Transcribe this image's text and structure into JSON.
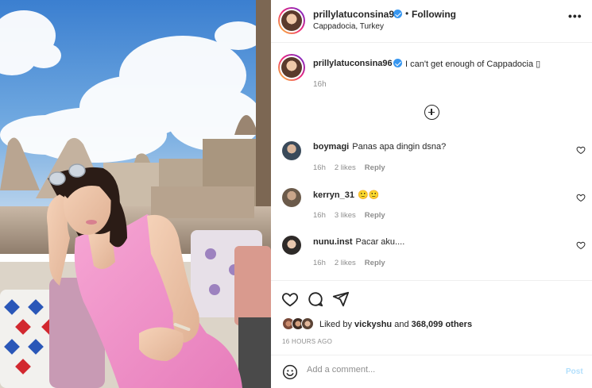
{
  "post": {
    "username": "prillylatuconsina96",
    "separator": "•",
    "follow_status": "Following",
    "location": "Cappadocia, Turkey",
    "more_icon": "more-horizontal-icon",
    "image_alt": "Woman in pink dress sitting on a rooftop terrace in Cappadocia"
  },
  "caption": {
    "username": "prillylatuconsina96",
    "text": "I can't get enough of Cappadocia ▯",
    "time": "16h"
  },
  "load_more_icon": "plus-circle-icon",
  "comments": [
    {
      "username": "boymagi",
      "text": "Panas apa dingin dsna?",
      "time": "16h",
      "likes": "2 likes",
      "reply": "Reply",
      "avatar_color": "#3a4a5a"
    },
    {
      "username": "kerryn_31",
      "text": "🙂🙂",
      "time": "16h",
      "likes": "3 likes",
      "reply": "Reply",
      "avatar_color": "#6b5a4a"
    },
    {
      "username": "nunu.inst",
      "text": "Pacar aku....",
      "time": "16h",
      "likes": "2 likes",
      "reply": "Reply",
      "avatar_color": "#2e2a28"
    }
  ],
  "actions": {
    "like_icon": "heart-icon",
    "comment_icon": "comment-icon",
    "share_icon": "send-icon"
  },
  "likes": {
    "prefix": "Liked by",
    "user": "vickyshu",
    "conjunction": "and",
    "others": "368,099 others"
  },
  "post_age": "16 HOURS AGO",
  "composer": {
    "emoji_icon": "smiley-icon",
    "placeholder": "Add a comment...",
    "post_label": "Post"
  },
  "colors": {
    "accent": "#0095f6",
    "muted": "#8e8e8e",
    "verified": "#3897f0",
    "post_disabled": "#b2dffc"
  }
}
